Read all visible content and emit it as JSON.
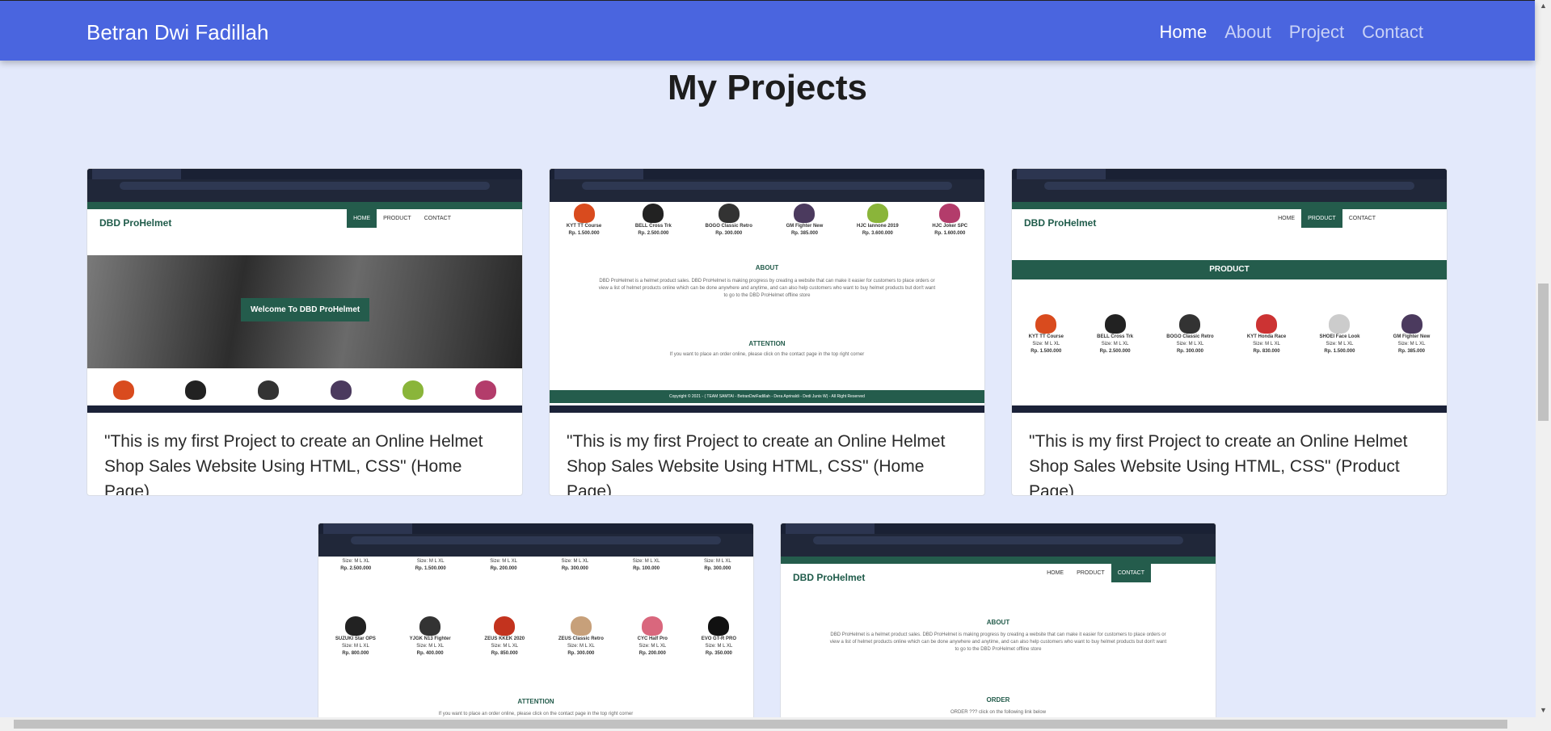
{
  "navbar": {
    "brand": "Betran Dwi Fadillah",
    "links": [
      "Home",
      "About",
      "Project",
      "Contact"
    ],
    "active": "Home",
    "bg_color": "#4a65df"
  },
  "page_title": "My Projects",
  "shot_common": {
    "site_logo": "DBD ProHelmet",
    "menu_home": "HOME",
    "menu_product": "PRODUCT",
    "menu_contact": "CONTACT",
    "accent_color": "#245c4c"
  },
  "cards": [
    {
      "caption": "\"This is my first Project to create an Online Helmet Shop Sales Website Using HTML, CSS\" (Home Page)",
      "hero_button": "Welcome To DBD ProHelmet"
    },
    {
      "caption": "\"This is my first Project to create an Online Helmet Shop Sales Website Using HTML, CSS\" (Home Page)",
      "products": [
        {
          "name": "KYT TT Course",
          "price": "Rp. 1.500.000"
        },
        {
          "name": "BELL Cross Trk",
          "price": "Rp. 2.500.000"
        },
        {
          "name": "BOGO Classic Retro",
          "price": "Rp. 300.000"
        },
        {
          "name": "GM Fighter New",
          "price": "Rp. 385.000"
        },
        {
          "name": "HJC Iannone 2019",
          "price": "Rp. 3.600.000"
        },
        {
          "name": "HJC Joker SPC",
          "price": "Rp. 1.600.000"
        }
      ],
      "about_heading": "ABOUT",
      "about_text": "DBD ProHelmet is a helmet product sales. DBD ProHelmet is making progress by creating a website that can make it easier for customers to place orders or view a list of helmet products online which can be done anywhere and anytime, and can also help customers who want to buy helmet products but don't want to go to the DBD ProHelmet offline store",
      "attention_heading": "ATTENTION",
      "attention_text": "If you want to place an order online, please click on the contact page in the top right corner",
      "footer_text": "Copyright © 2021 - ( TEAM SAMTAI - BetranDwiFadillah - Dera Aprinaldi - Dedi Junis W) - All Right Reserved"
    },
    {
      "caption": "\"This is my first Project to create an Online Helmet Shop Sales Website Using HTML, CSS\" (Product Page)",
      "band_label": "PRODUCT",
      "size_label": "Size: M L XL",
      "products": [
        {
          "name": "KYT TT Course",
          "price": "Rp. 1.500.000"
        },
        {
          "name": "BELL Cross Trk",
          "price": "Rp. 2.500.000"
        },
        {
          "name": "BOGO Classic Retro",
          "price": "Rp. 300.000"
        },
        {
          "name": "KYT Honda Race",
          "price": "Rp. 830.000"
        },
        {
          "name": "SHOEI Face Look",
          "price": "Rp. 1.500.000"
        },
        {
          "name": "GM Fighter New",
          "price": "Rp. 385.000"
        }
      ]
    },
    {
      "size_label": "Size: M L XL",
      "top_prices": [
        "Rp. 2.500.000",
        "Rp. 1.500.000",
        "Rp. 200.000",
        "Rp. 300.000",
        "Rp. 100.000",
        "Rp. 300.000"
      ],
      "products": [
        {
          "name": "SUZUKI Star OPS",
          "price": "Rp. 800.000"
        },
        {
          "name": "YJGK N13 Fighter",
          "price": "Rp. 400.000"
        },
        {
          "name": "ZEUS KKEK 2020",
          "price": "Rp. 850.000"
        },
        {
          "name": "ZEUS Classic Retro",
          "price": "Rp. 300.000"
        },
        {
          "name": "CYC Half Pro",
          "price": "Rp. 200.000"
        },
        {
          "name": "EVO GT-R PRO",
          "price": "Rp. 350.000"
        }
      ],
      "attention_heading": "ATTENTION",
      "attention_text": "If you want to place an order online, please click on the contact page in the top right corner"
    },
    {
      "about_heading": "ABOUT",
      "about_text": "DBD ProHelmet is a helmet product sales. DBD ProHelmet is making progress by creating a website that can make it easier for customers to place orders or view a list of helmet products online which can be done anywhere and anytime, and can also help customers who want to buy helmet products but don't want to go to the DBD ProHelmet offline store",
      "order_heading": "ORDER",
      "order_text": "ORDER ??? click on the following link below"
    }
  ]
}
